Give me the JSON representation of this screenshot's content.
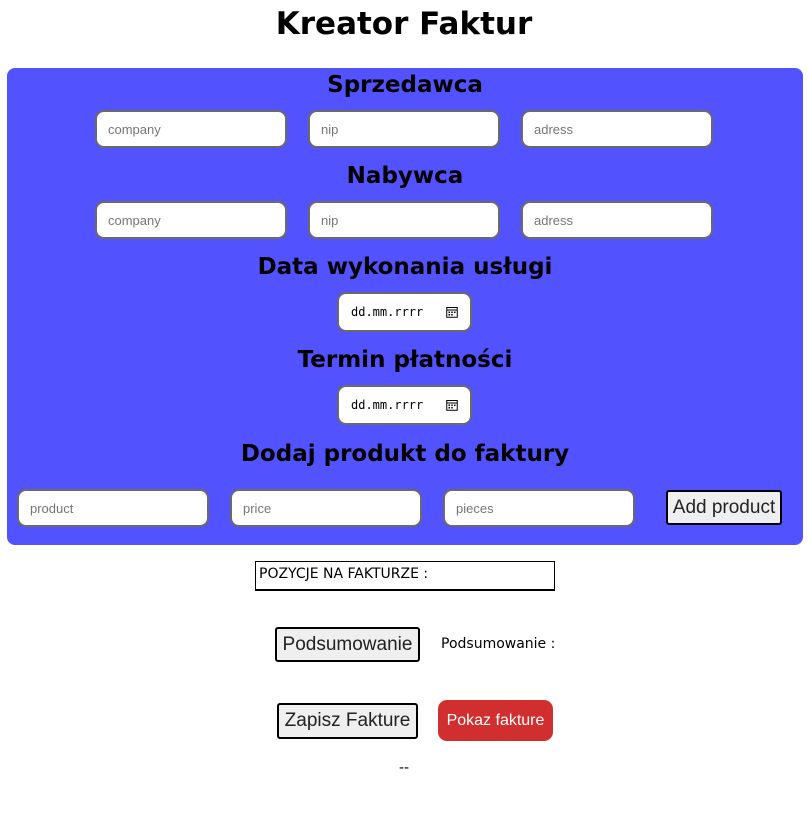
{
  "page": {
    "title": "Kreator Faktur"
  },
  "seller": {
    "heading": "Sprzedawca",
    "company_placeholder": "company",
    "nip_placeholder": "nip",
    "address_placeholder": "adress"
  },
  "buyer": {
    "heading": "Nabywca",
    "company_placeholder": "company",
    "nip_placeholder": "nip",
    "address_placeholder": "adress"
  },
  "service_date": {
    "heading": "Data wykonania usługi",
    "value": "dd.mm.rrrr"
  },
  "payment_term": {
    "heading": "Termin płatności",
    "value": "dd.mm.rrrr"
  },
  "add_product": {
    "heading": "Dodaj produkt do faktury",
    "product_placeholder": "product",
    "price_placeholder": "price",
    "pieces_placeholder": "pieces",
    "button_label": "Add product"
  },
  "positions": {
    "label": "POZYCJE NA FAKTURZE :"
  },
  "summary": {
    "button_label": "Podsumowanie",
    "text": "Podsumowanie :"
  },
  "actions": {
    "save_label": "Zapisz Fakture",
    "show_label": "Pokaz fakture"
  },
  "footer": {
    "text": "--"
  },
  "colors": {
    "panel": "#5252fe",
    "show_button": "#d12f2f"
  },
  "icons": {
    "date_picker": "calendar-icon"
  }
}
